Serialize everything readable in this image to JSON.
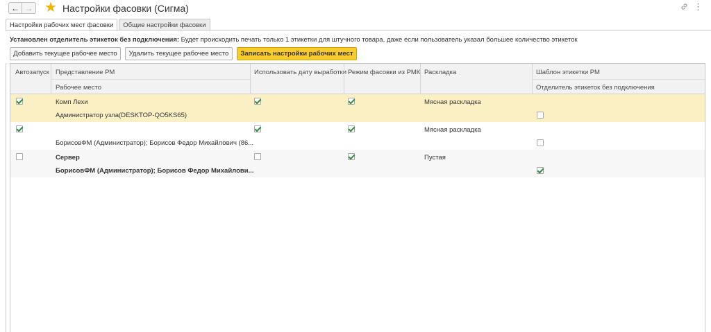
{
  "window": {
    "title": "Настройки фасовки (Сигма)",
    "back_icon": "←",
    "forward_icon": "→",
    "favorite_icon": "★",
    "link_icon": "🔗",
    "more_icon": "⋮"
  },
  "tabs": [
    {
      "label": "Настройки рабочих мест фасовки",
      "active": true
    },
    {
      "label": "Общие настройки фасовки",
      "active": false
    }
  ],
  "notice": {
    "bold": "Установлен отделитель этикеток без подключения:",
    "text": " Будет происходить печать только 1 этикетки для штучного товара, даже если пользователь указал большее количество этикеток"
  },
  "toolbar": {
    "add_label": "Добавить текущее рабочее место",
    "delete_label": "Удалить текущее рабочее место",
    "save_label": "Записать настройки рабочих мест"
  },
  "columns": {
    "autostart": "Автозапуск",
    "presentation": "Представление РМ",
    "workplace": "Рабочее место",
    "use_date": "Использовать дату выработки",
    "mode": "Режим фасовки из РМК",
    "layout": "Раскладка",
    "template": "Шаблон этикетки РМ",
    "separator": "Отделитель этикеток без подключения"
  },
  "rows": [
    {
      "autostart": true,
      "presentation": "Комп Лехи",
      "workplace": "Администратор узла(DESKTOP-QO5KS65)",
      "use_date": true,
      "mode": true,
      "layout": "Мясная раскладка",
      "template": "",
      "separator": false,
      "bold": false
    },
    {
      "autostart": true,
      "presentation": "",
      "workplace": "БорисовФМ (Администратор); Борисов Федор Михайлович (86...",
      "use_date": true,
      "mode": true,
      "layout": "Мясная раскладка",
      "template": "",
      "separator": false,
      "bold": false
    },
    {
      "autostart": false,
      "presentation": "Сервер",
      "workplace": "БорисовФМ (Администратор); Борисов Федор Михайлови...",
      "use_date": false,
      "mode": true,
      "layout": "Пустая",
      "template": "",
      "separator": true,
      "bold": true
    }
  ],
  "colors": {
    "accent": "#f8cc2a",
    "selected_row": "#fbf0c4",
    "check": "#2e8b3e",
    "star": "#f0b400"
  }
}
